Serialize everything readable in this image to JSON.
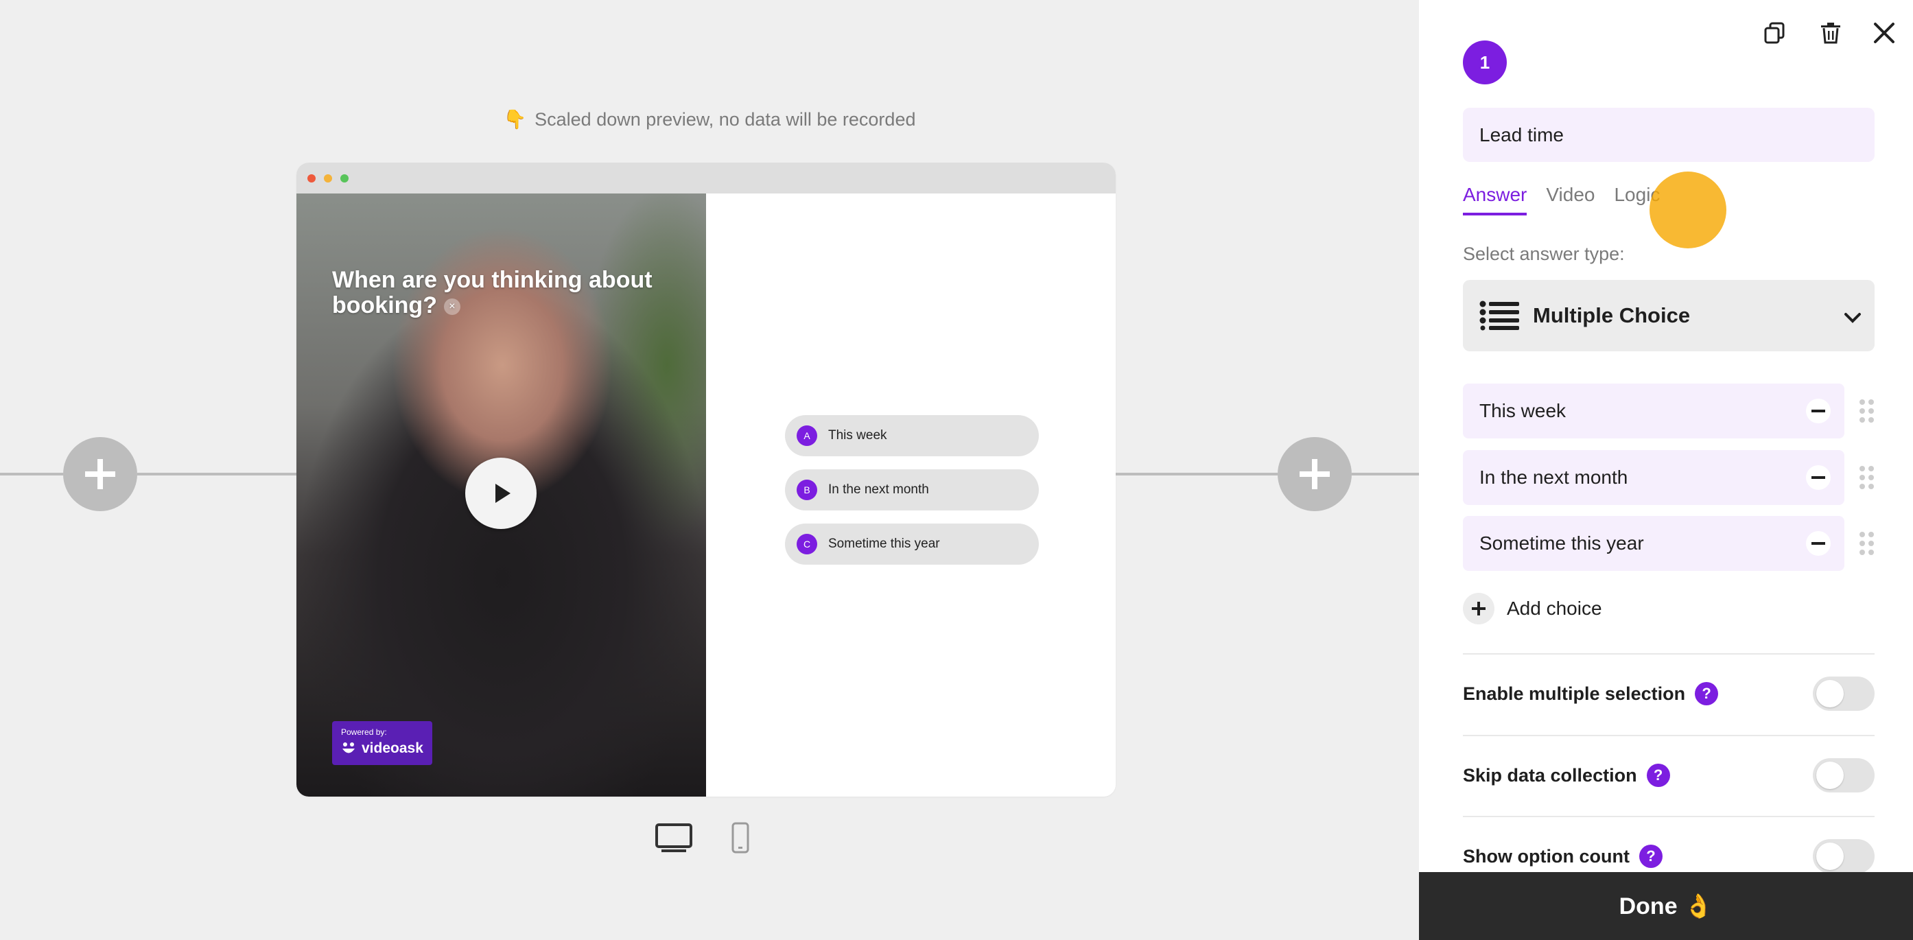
{
  "preview": {
    "note_icon": "👇",
    "note": "Scaled down preview, no data will be recorded"
  },
  "video": {
    "question": "When are you thinking about booking?",
    "close_glyph": "×",
    "powered_by": "Powered by:",
    "brand": "videoask"
  },
  "choices_preview": [
    {
      "letter": "A",
      "label": "This week"
    },
    {
      "letter": "B",
      "label": "In the next month"
    },
    {
      "letter": "C",
      "label": "Sometime this year"
    }
  ],
  "panel": {
    "step_number": "1",
    "title_value": "Lead time",
    "tabs": [
      "Answer",
      "Video",
      "Logic"
    ],
    "active_tab": "Answer",
    "answer_type_label": "Select answer type:",
    "answer_type": "Multiple Choice",
    "choices": [
      "This week",
      "In the next month",
      "Sometime this year"
    ],
    "add_choice": "Add choice",
    "settings": [
      {
        "label": "Enable multiple selection",
        "help": "?",
        "enabled": false
      },
      {
        "label": "Skip data collection",
        "help": "?",
        "enabled": false
      },
      {
        "label": "Show option count",
        "help": "?",
        "enabled": false
      }
    ],
    "done_label": "Done 👌"
  },
  "colors": {
    "accent": "#7c1ee0",
    "choice_bg": "#f6effd",
    "done_bg": "#2b2b2b",
    "badge": "#5a1fb4",
    "cursor": "#f6a800"
  },
  "icons": [
    "copy-icon",
    "trash-icon",
    "close-icon",
    "list-icon",
    "chevron-down-icon",
    "minus-icon",
    "drag-handle-icon",
    "plus-icon",
    "help-icon",
    "play-icon",
    "desktop-icon",
    "mobile-icon"
  ]
}
